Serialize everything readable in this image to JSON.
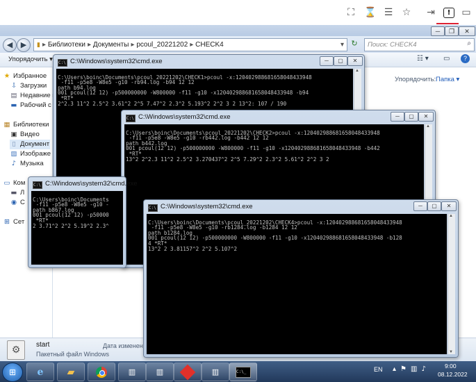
{
  "browser_toolbar": {
    "icons": [
      "screenshot-icon",
      "hourglass-icon",
      "database-icon",
      "favorites-star-icon",
      "login-icon",
      "alert-icon",
      "chat-icon"
    ]
  },
  "explorer": {
    "breadcrumb": [
      "Библиотеки",
      "Документы",
      "pcoul_20221202",
      "CHECK4"
    ],
    "search_placeholder": "Поиск: CHECK4",
    "organize_label": "Упорядочить ▾",
    "arrange_by_label": "Упорядочить:",
    "arrange_by_value": "Папка ▾",
    "nav": {
      "favorites": "Избранное",
      "downloads": "Загрузки",
      "recent": "Недавние м",
      "desktop": "Рабочий с",
      "libraries": "Библиотеки",
      "video": "Видео",
      "documents": "Документ",
      "images": "Изображе",
      "music": "Музыка",
      "computer": "Ком",
      "drive1": "Л",
      "drive2": "С",
      "network": "Сет"
    },
    "details": {
      "filename": "start",
      "filetype": "Пакетный файл Windows",
      "date_label": "Дата изменения"
    }
  },
  "cmd1": {
    "title": "C:\\Windows\\system32\\cmd.exe",
    "lines": "\nC:\\Users\\boinc\\Documents\\pcoul_20221202\\CHECK1>pcoul -x:120402988681658048433948\n -f11 -p5e8 -W8e5 -g10 -rb94.log -b94 12 12\npath b94.log\n001 pcoul(12 12) -p500000000 -W800000 -f11 -g10 -x120402988681658048433948 -b94\n *RT*\n2^2.3 11^2 2.5^2 3.61^2 2^5 7.47^2 2.3^2 5.193^2 2^2 3 2 13^2: 107 / 190"
  },
  "cmd2": {
    "title": "C:\\Windows\\system32\\cmd.exe",
    "lines": "\nC:\\Users\\boinc\\Documents\\pcoul_20221202\\CHECK2>pcoul -x:120402988681658048433948\n -f11 -p5e8 -W8e5 -g10 -rb442.log -b442 12 12\npath b442.log\n001 pcoul(12 12) -p500000000 -W800000 -f11 -g10 -x120402988681658048433948 -b442\n *RT*\n13^2 2^2.3 11^2 2.5^2 3.270437^2 2^5 7.29^2 2.3^2 5.61^2 2^2 3 2"
  },
  "cmd3": {
    "title": "C:\\Windows\\system32\\cmd.exe",
    "lines": "\nC:\\Users\\boinc\\Documents\n -f11 -p5e8 -W8e5 -g10 -\npath b867.log\n001 pcoul(12 12) -p50000\n *RT*\n2 3.71^2 2^2 5.19^2 2.3^"
  },
  "cmd4": {
    "title": "C:\\Windows\\system32\\cmd.exe",
    "lines": "\nC:\\Users\\boinc\\Documents\\pcoul_20221202\\CHECK4>pcoul -x:120402988681658048433948\n -f11 -p5e8 -W8e5 -g10 -rb1284.log -b1284 12 12\npath b1284.log\n001 pcoul(12 12) -p500000000 -W800000 -f11 -g10 -x120402988681658048433948 -b128\n4 *RT*\n13^2 2 3.81157^2 2^2 5.107^2"
  },
  "taskbar": {
    "lang": "EN",
    "time": "9:00",
    "date": "08.12.2022",
    "cmd_button_label": "C:\\_"
  }
}
